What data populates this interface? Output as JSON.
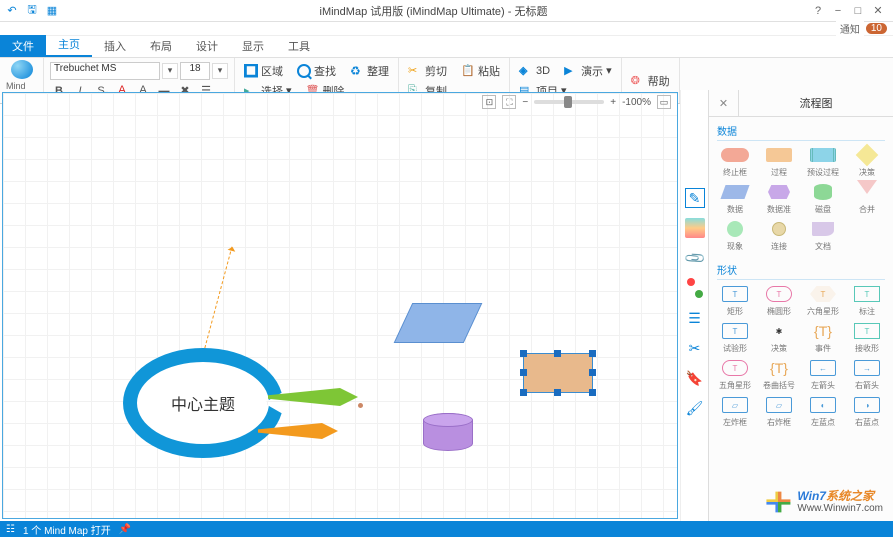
{
  "title": "iMindMap 试用版 (iMindMap Ultimate) - 无标题",
  "notify_label": "通知",
  "notify_count": "10",
  "qat": [
    "↶",
    "🖫",
    "▦"
  ],
  "menu": {
    "file": "文件",
    "items": [
      "主页",
      "插入",
      "布局",
      "设计",
      "显示",
      "工具"
    ],
    "active": 0
  },
  "logo_label": "Mind Map",
  "font_name": "Trebuchet MS",
  "font_size": "18",
  "ribbon": {
    "g1": [
      {
        "l": "区域"
      },
      {
        "l": "查找"
      },
      {
        "l": "整理"
      }
    ],
    "g1b": [
      {
        "l": "选择"
      },
      {
        "l": "删除"
      }
    ],
    "g2": [
      {
        "l": "剪切"
      },
      {
        "l": "粘贴"
      }
    ],
    "g2b": [
      {
        "l": "复制"
      }
    ],
    "g3": [
      {
        "l": "3D"
      },
      {
        "l": "演示"
      }
    ],
    "g3b": [
      {
        "l": "项目"
      }
    ],
    "g4": [
      {
        "l": "帮助"
      }
    ]
  },
  "central_text": "中心主题",
  "zoom": "-100%",
  "panel": {
    "title": "流程图",
    "sec1": "数据",
    "sec2": "形状",
    "shapes1": [
      {
        "n": "终止框",
        "c": "sic-term"
      },
      {
        "n": "过程",
        "c": "sic-proc"
      },
      {
        "n": "预设过程",
        "c": "sic-pred"
      },
      {
        "n": "决策",
        "c": "sic-dec"
      },
      {
        "n": "数据",
        "c": "sic-data"
      },
      {
        "n": "数据准",
        "c": "sic-prep"
      },
      {
        "n": "磁盘",
        "c": "sic-db"
      },
      {
        "n": "合并",
        "c": "sic-merge"
      },
      {
        "n": "现象",
        "c": "sic-disp"
      },
      {
        "n": "连接",
        "c": "sic-conn"
      },
      {
        "n": "文档",
        "c": "sic-doc"
      }
    ],
    "shapes2": [
      {
        "n": "矩形",
        "t": "T",
        "c": "c-blue"
      },
      {
        "n": "椭圆形",
        "t": "T",
        "c": "c-pink"
      },
      {
        "n": "六角星形",
        "t": "T",
        "c": "c-orange"
      },
      {
        "n": "标注",
        "t": "T",
        "c": "c-teal"
      },
      {
        "n": "试验形",
        "t": "T",
        "c": "c-blue"
      },
      {
        "n": "决策",
        "t": "✱",
        "c": "star"
      },
      {
        "n": "事件",
        "t": "{T}",
        "c": "brace"
      },
      {
        "n": "接收形",
        "t": "T",
        "c": "c-teal"
      },
      {
        "n": "五角星形",
        "t": "T",
        "c": "c-pink"
      },
      {
        "n": "卷曲括号",
        "t": "{T}",
        "c": "brace"
      },
      {
        "n": "左箭头",
        "t": "←",
        "c": "c-blue"
      },
      {
        "n": "右箭头",
        "t": "→",
        "c": "c-blue"
      },
      {
        "n": "左炸框",
        "t": "▱",
        "c": "c-blue"
      },
      {
        "n": "右炸框",
        "t": "▱",
        "c": "c-blue"
      },
      {
        "n": "左蓝点",
        "t": "◐",
        "c": "c-blue"
      },
      {
        "n": "右蓝点",
        "t": "◑",
        "c": "c-blue"
      }
    ]
  },
  "watermark": {
    "brand": "Win7",
    "suffix": "系统之家",
    "url": "Www.Winwin7.com"
  },
  "status": {
    "text": "1 个 Mind Map 打开"
  }
}
